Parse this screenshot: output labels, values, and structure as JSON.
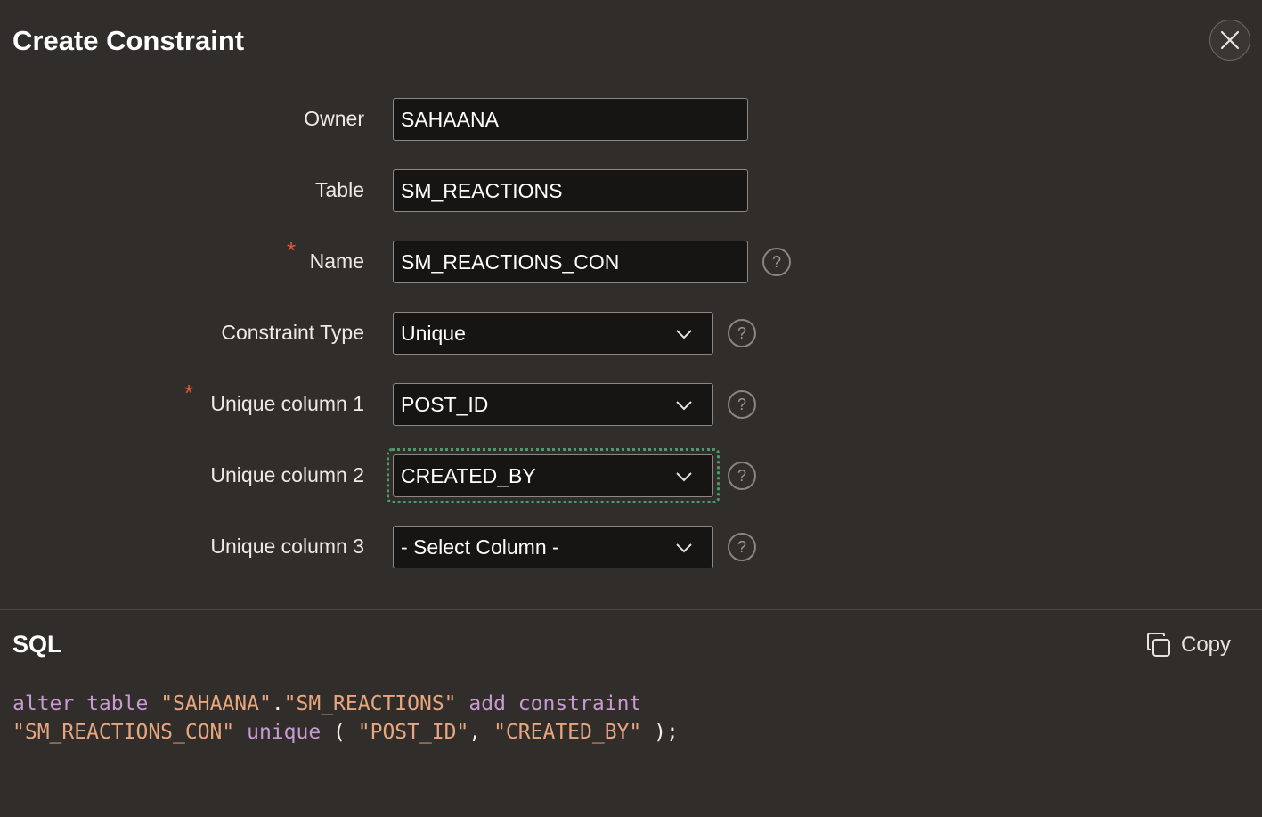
{
  "dialog": {
    "title": "Create Constraint",
    "close_icon": "close-icon"
  },
  "form": {
    "owner": {
      "label": "Owner",
      "value": "SAHAANA"
    },
    "table": {
      "label": "Table",
      "value": "SM_REACTIONS"
    },
    "name": {
      "label": "Name",
      "value": "SM_REACTIONS_CON",
      "required_marker": "*"
    },
    "constraint_type": {
      "label": "Constraint Type",
      "value": "Unique"
    },
    "unique_column_1": {
      "label": "Unique column 1",
      "value": "POST_ID",
      "required_marker": "*"
    },
    "unique_column_2": {
      "label": "Unique column 2",
      "value": "CREATED_BY"
    },
    "unique_column_3": {
      "label": "Unique column 3",
      "value": "- Select Column -"
    },
    "help_glyph": "?"
  },
  "sql": {
    "title": "SQL",
    "copy_label": "Copy",
    "line1": {
      "t1": "alter table",
      "t2": " ",
      "t3": "\"SAHAANA\"",
      "t4": ".",
      "t5": "\"SM_REACTIONS\"",
      "t6": " ",
      "t7": "add constraint"
    },
    "line2": {
      "t1": "\"SM_REACTIONS_CON\"",
      "t2": " ",
      "t3": "unique",
      "t4": " ( ",
      "t5": "\"POST_ID\"",
      "t6": ", ",
      "t7": "\"CREATED_BY\"",
      "t8": " );"
    }
  },
  "colors": {
    "background": "#312d2a",
    "field_background": "#161513",
    "required": "#e2583d",
    "focus": "#4d9a6b",
    "keyword": "#c79ad1",
    "string": "#e8a67e"
  }
}
